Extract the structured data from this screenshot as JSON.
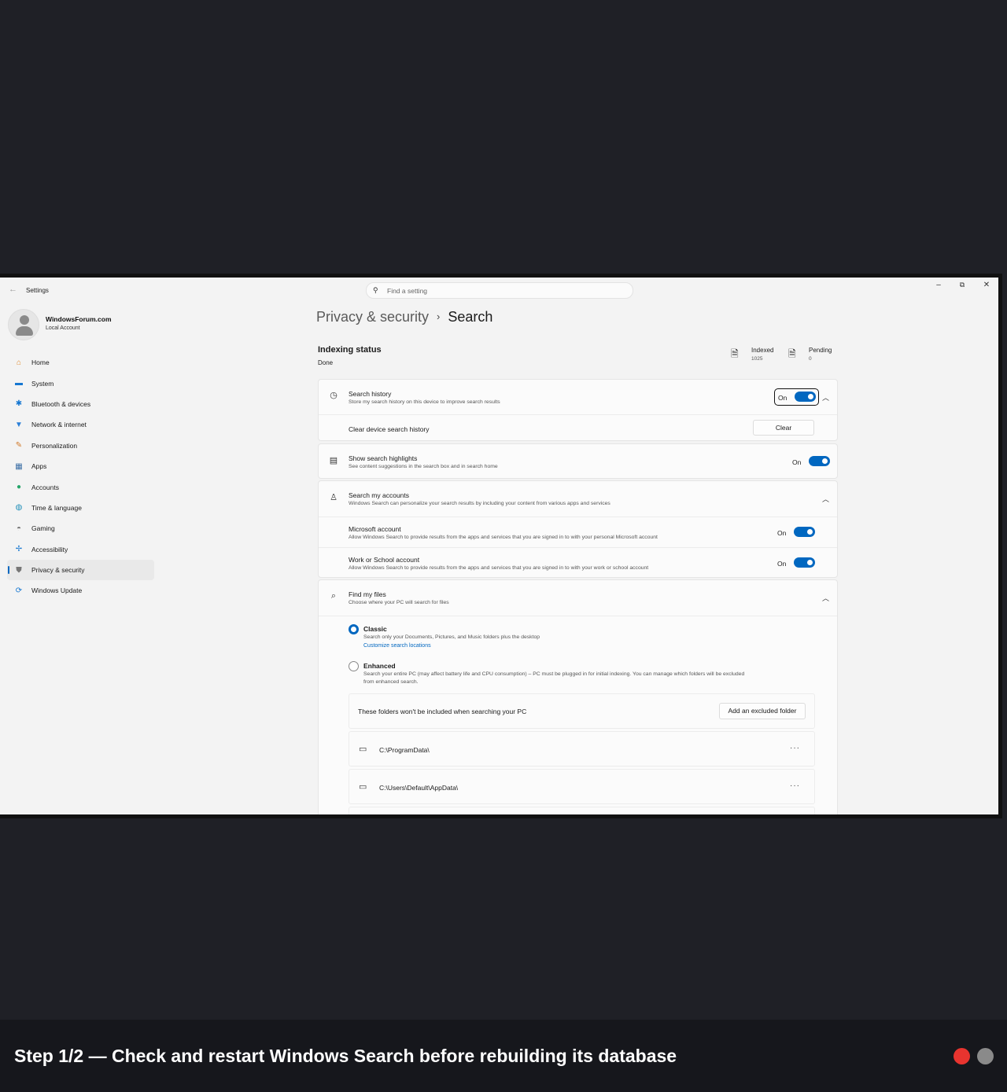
{
  "window": {
    "title": "Settings",
    "search_placeholder": "Find a setting",
    "controls": {
      "minimize": "–",
      "maximize": "⧉",
      "close": "✕"
    }
  },
  "profile": {
    "name": "WindowsForum.com",
    "account_type": "Local Account"
  },
  "sidebar": {
    "items": [
      {
        "label": "Home",
        "icon": "home-icon",
        "active": false
      },
      {
        "label": "System",
        "icon": "system-icon",
        "active": false
      },
      {
        "label": "Bluetooth & devices",
        "icon": "bluetooth-icon",
        "active": false
      },
      {
        "label": "Network & internet",
        "icon": "wifi-icon",
        "active": false
      },
      {
        "label": "Personalization",
        "icon": "brush-icon",
        "active": false
      },
      {
        "label": "Apps",
        "icon": "apps-icon",
        "active": false
      },
      {
        "label": "Accounts",
        "icon": "person-icon",
        "active": false
      },
      {
        "label": "Time & language",
        "icon": "globe-icon",
        "active": false
      },
      {
        "label": "Gaming",
        "icon": "gamepad-icon",
        "active": false
      },
      {
        "label": "Accessibility",
        "icon": "accessibility-icon",
        "active": false
      },
      {
        "label": "Privacy & security",
        "icon": "shield-icon",
        "active": true
      },
      {
        "label": "Windows Update",
        "icon": "update-icon",
        "active": false
      }
    ]
  },
  "breadcrumb": {
    "parent": "Privacy & security",
    "separator": "›",
    "current": "Search"
  },
  "indexing": {
    "title": "Indexing status",
    "status": "Done",
    "indexed_label": "Indexed",
    "indexed_value": "1025",
    "pending_label": "Pending",
    "pending_value": "0"
  },
  "search_history": {
    "title": "Search history",
    "description": "Store my search history on this device to improve search results",
    "toggle_label": "On",
    "clear_row_label": "Clear device search history",
    "clear_button": "Clear"
  },
  "highlights": {
    "title": "Show search highlights",
    "description": "See content suggestions in the search box and in search home",
    "toggle_label": "On"
  },
  "accounts": {
    "title": "Search my accounts",
    "description": "Windows Search can personalize your search results by including your content from various apps and services",
    "microsoft": {
      "title": "Microsoft account",
      "description": "Allow Windows Search to provide results from the apps and services that you are signed in to with your personal Microsoft account",
      "toggle_label": "On"
    },
    "work": {
      "title": "Work or School account",
      "description": "Allow Windows Search to provide results from the apps and services that you are signed in to with your work or school account",
      "toggle_label": "On"
    }
  },
  "find_files": {
    "title": "Find my files",
    "description": "Choose where your PC will search for files",
    "classic": {
      "label": "Classic",
      "description": "Search only your Documents, Pictures, and Music folders plus the desktop",
      "link": "Customize search locations",
      "selected": true
    },
    "enhanced": {
      "label": "Enhanced",
      "description_line1": "Search your entire PC (may affect battery life and CPU consumption) – PC must be plugged in for initial indexing. You can manage which folders will be excluded",
      "description_line2": "from enhanced search.",
      "selected": false
    },
    "excluded": {
      "header": "These folders won't be included when searching your PC",
      "add_button": "Add an excluded folder",
      "folders": [
        "C:\\ProgramData\\",
        "C:\\Users\\Default\\AppData\\"
      ],
      "more": "···"
    }
  },
  "caption": {
    "text": "Step 1/2 — Check and restart Windows Search before rebuilding its database",
    "dots": [
      "#e8342f",
      "#8a8a8a"
    ]
  }
}
